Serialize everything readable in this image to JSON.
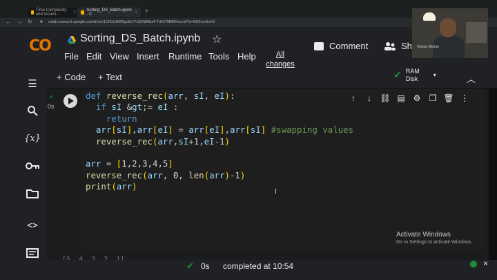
{
  "browser": {
    "tabs": [
      {
        "title": "Time Complexity and recursi..."
      },
      {
        "title": "Sorting_DS_Batch.ipynb - C"
      }
    ],
    "new_tab": "+",
    "url": "colab.research.google.com/drive/1CfSh1NW5gc9vJYxQKMl6bz4-TdJdT9BB8#scrollTo=hW2oerSuH1"
  },
  "header": {
    "logo": "CO",
    "title": "Sorting_DS_Batch.ipynb",
    "star": "☆",
    "menus": [
      "File",
      "Edit",
      "View",
      "Insert",
      "Runtime",
      "Tools",
      "Help"
    ],
    "all_changes": "All changes",
    "comment": "Comment",
    "share": "Sha",
    "webcam_name": "Vishnu Mohan"
  },
  "toolbar": {
    "add_code": "+ Code",
    "add_text": "+ Text",
    "ram": "RAM",
    "disk": "Disk",
    "caret": "▾",
    "collapse": "︿"
  },
  "sidebar_icons": [
    "toc-icon",
    "search-icon",
    "variables-icon",
    "key-icon",
    "folder-icon",
    "code-snippets-icon",
    "terminal-icon"
  ],
  "cell": {
    "exec_time": "0s",
    "code_lines": [
      "def reverse_rec(arr, sI, eI):",
      "  if sI >= eI :",
      "    return",
      "  arr[sI],arr[eI] = arr[eI],arr[sI] #swapping values",
      "  reverse_rec(arr,sI+1,eI-1)",
      "",
      "arr = [1,2,3,4,5]",
      "reverse_rec(arr, 0, len(arr)-1)",
      "print(arr)"
    ],
    "next_cell_peek": "[5, 4, 3, 2, 1]"
  },
  "watermark": {
    "title": "Activate Windows",
    "subtitle": "Go to Settings to activate Windows."
  },
  "status": {
    "time": "0s",
    "message": "completed at 10:54"
  },
  "colors": {
    "accent_green": "#1e8e3e",
    "logo_orange": "#f9ab00",
    "background": "#202124"
  }
}
